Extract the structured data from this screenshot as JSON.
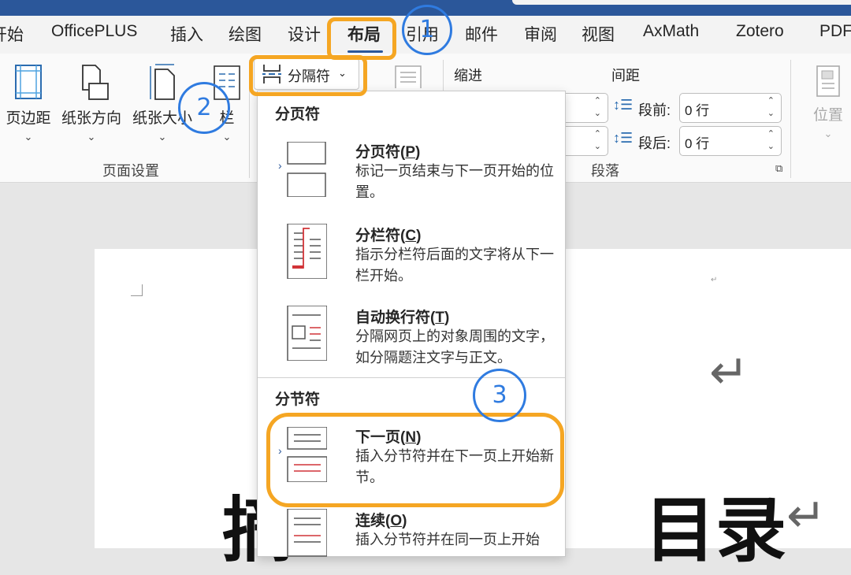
{
  "tabs": [
    {
      "label": "开始"
    },
    {
      "label": "OfficePLUS"
    },
    {
      "label": "插入"
    },
    {
      "label": "绘图"
    },
    {
      "label": "设计"
    },
    {
      "label": "布局"
    },
    {
      "label": "引用"
    },
    {
      "label": "邮件"
    },
    {
      "label": "审阅"
    },
    {
      "label": "视图"
    },
    {
      "label": "AxMath"
    },
    {
      "label": "Zotero"
    },
    {
      "label": "PDF"
    }
  ],
  "ribbon": {
    "page_setup": {
      "group_label": "页面设置",
      "margins_label": "页边距",
      "orientation_label": "纸张方向",
      "size_label": "纸张大小",
      "columns_label": "栏"
    },
    "breaks_label": "分隔符",
    "paragraph": {
      "indent_label": "缩进",
      "spacing_label": "间距",
      "before_label": "段前:",
      "before_value": "0 行",
      "after_label": "段后:",
      "after_value": "0 行",
      "group_label": "段落"
    },
    "position_label": "位置"
  },
  "menu": {
    "page_breaks_header": "分页符",
    "section_breaks_header": "分节符",
    "items": [
      {
        "title_pre": "分页符(",
        "key": "P",
        "title_post": ")",
        "desc": "标记一页结束与下一页开始的位置。",
        "icon": "page-break-icon"
      },
      {
        "title_pre": "分栏符(",
        "key": "C",
        "title_post": ")",
        "desc": "指示分栏符后面的文字将从下一栏开始。",
        "icon": "column-break-icon"
      },
      {
        "title_pre": "自动换行符(",
        "key": "T",
        "title_post": ")",
        "desc": "分隔网页上的对象周围的文字，如分隔题注文字与正文。",
        "icon": "text-wrapping-break-icon"
      },
      {
        "title_pre": "下一页(",
        "key": "N",
        "title_post": ")",
        "desc": "插入分节符并在下一页上开始新节。",
        "icon": "next-page-section-icon"
      },
      {
        "title_pre": "连续(",
        "key": "O",
        "title_post": ")",
        "desc": "插入分节符并在同一页上开始",
        "icon": "continuous-section-icon"
      }
    ]
  },
  "document": {
    "title_left_char": "摘",
    "title_right_chars": "目录"
  },
  "annotations": {
    "step1": "1",
    "step2": "2",
    "step3": "3"
  },
  "colors": {
    "highlight": "#f5a623",
    "circle": "#2f7be0",
    "accent": "#2b579a"
  }
}
